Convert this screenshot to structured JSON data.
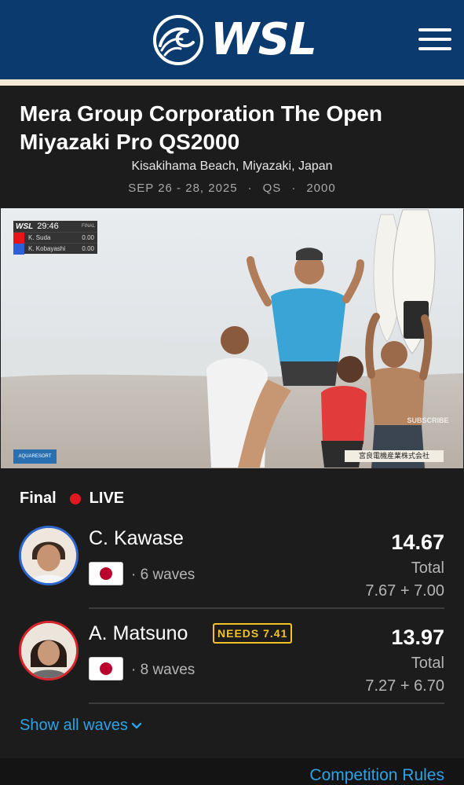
{
  "header": {
    "logo_text": "WSL",
    "logo_icon": "wsl-wave-logo",
    "menu_icon": "hamburger-menu-icon",
    "bg_color": "#0b3a6f"
  },
  "event": {
    "title": "Mera Group Corporation The Open Miyazaki Pro QS2000",
    "location": "Kisakihama Beach, Miyazaki, Japan",
    "dates": "SEP 26 - 28, 2025",
    "tour": "QS",
    "rating": "2000"
  },
  "video": {
    "scorebug_logo": "WSL",
    "clock": "29:46",
    "state": "FINAL",
    "rows": [
      {
        "name": "K. Suda",
        "score": "0.00",
        "color": "#e8141b"
      },
      {
        "name": "K. Kobayashi",
        "score": "0.00",
        "color": "#2d5fd6"
      }
    ],
    "sponsor": "AQUARESORT",
    "sign": "宮良電機産業株式会社",
    "subscribe": "SUBSCRIBE"
  },
  "heat": {
    "round": "Final",
    "status": "LIVE",
    "live_color": "#e1191f",
    "athletes": [
      {
        "name": "C. Kawase",
        "country_flag": "japan-flag",
        "waves": "· 6 waves",
        "total": "14.67",
        "total_label": "Total",
        "breakdown": "7.67 + 7.00",
        "jersey_color": "#2e66c9"
      },
      {
        "name": "A. Matsuno",
        "needs": "NEEDS 7.41",
        "country_flag": "japan-flag",
        "waves": "· 8 waves",
        "total": "13.97",
        "total_label": "Total",
        "breakdown": "7.27 + 6.70",
        "jersey_color": "#d6262c"
      }
    ],
    "show_all_label": "Show all waves"
  },
  "footer": {
    "rules_label": "Competition Rules"
  },
  "colors": {
    "accent_link": "#2da3e6",
    "needs_badge": "#f3c22b"
  }
}
